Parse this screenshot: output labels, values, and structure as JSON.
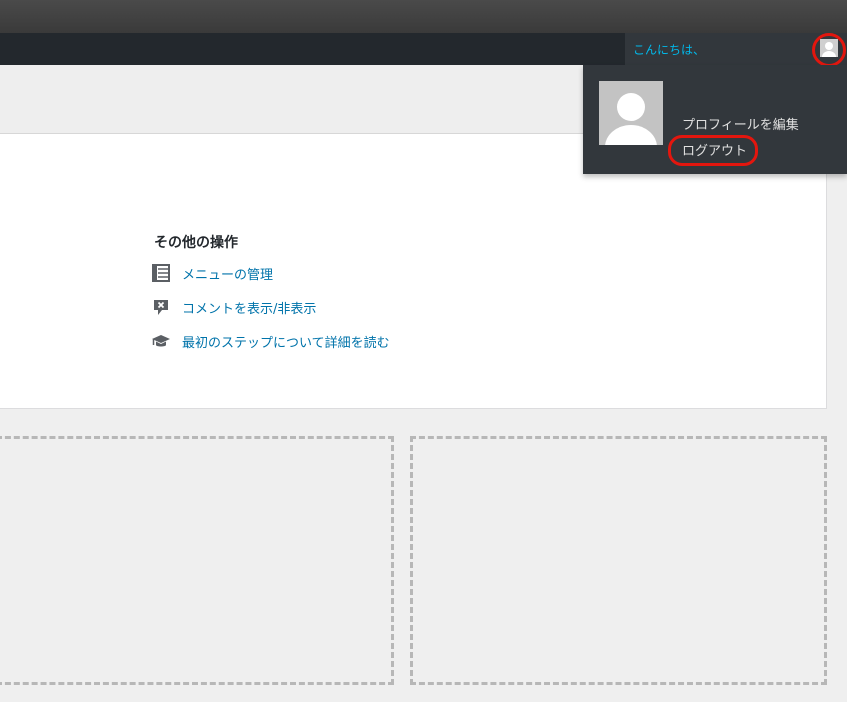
{
  "adminbar": {
    "greeting": "こんにちは、",
    "highlight_color": "#e3160e"
  },
  "account_menu": {
    "edit_profile": "プロフィールを編集",
    "logout": "ログアウト"
  },
  "welcome_panel": {
    "more_actions_title": "その他の操作",
    "actions": [
      {
        "label": "メニューの管理",
        "icon": "menu-list-icon"
      },
      {
        "label": "コメントを表示/非表示",
        "icon": "comment-toggle-icon"
      },
      {
        "label": "最初のステップについて詳細を読む",
        "icon": "learn-more-icon"
      }
    ]
  },
  "colors": {
    "link": "#0073aa",
    "greeting_link": "#00b9eb",
    "adminbar_bg": "#23282d",
    "dropdown_bg": "#32373c"
  }
}
